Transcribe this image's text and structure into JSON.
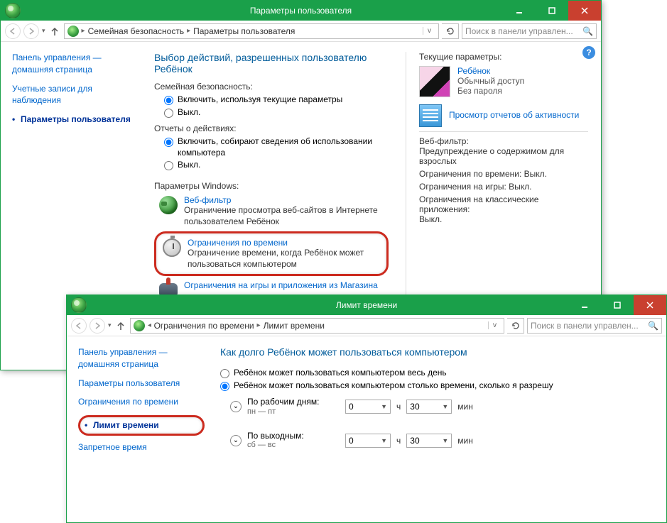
{
  "win1": {
    "title": "Параметры пользователя",
    "breadcrumb": {
      "a": "Семейная безопасность",
      "b": "Параметры пользователя"
    },
    "search_placeholder": "Поиск в панели управлен...",
    "sidebar": {
      "home": "Панель управления — домашняя страница",
      "accounts": "Учетные записи для наблюдения",
      "params": "Параметры пользователя"
    },
    "heading": "Выбор действий, разрешенных пользователю Ребёнок",
    "family_safety_label": "Семейная безопасность:",
    "fs_on": "Включить, используя текущие параметры",
    "fs_off": "Выкл.",
    "activity_label": "Отчеты о действиях:",
    "act_on": "Включить, собирают сведения об использовании компьютера",
    "act_off": "Выкл.",
    "win_params_label": "Параметры Windows:",
    "web_filter_title": "Веб-фильтр",
    "web_filter_desc": "Ограничение просмотра веб-сайтов в Интернете пользователем Ребёнок",
    "time_title": "Ограничения по времени",
    "time_desc": "Ограничение времени, когда Ребёнок может пользоваться компьютером",
    "games_title": "Ограничения на игры и приложения из Магазина",
    "right": {
      "current_label": "Текущие параметры:",
      "user_name": "Ребёнок",
      "user_type": "Обычный доступ",
      "user_pwd": "Без пароля",
      "report_link": "Просмотр отчетов об активности",
      "r1_label": "Веб-фильтр:",
      "r1_val": "Предупреждение о содержимом для взрослых",
      "r2": "Ограничения по времени: Выкл.",
      "r3": "Ограничения на игры: Выкл.",
      "r4_label": "Ограничения на классические приложения:",
      "r4_val": "Выкл."
    }
  },
  "win2": {
    "title": "Лимит времени",
    "breadcrumb": {
      "a": "Ограничения по времени",
      "b": "Лимит времени"
    },
    "search_placeholder": "Поиск в панели управлен...",
    "sidebar": {
      "home": "Панель управления — домашняя страница",
      "params": "Параметры пользователя",
      "time": "Ограничения по времени",
      "limit": "Лимит времени",
      "forbidden": "Запретное время"
    },
    "heading": "Как долго Ребёнок может пользоваться компьютером",
    "opt_all_day": "Ребёнок может пользоваться компьютером весь день",
    "opt_limited": "Ребёнок может пользоваться компьютером столько времени, сколько я разрешу",
    "weekday_label": "По рабочим дням:",
    "weekday_sub": "пн — пт",
    "weekend_label": "По выходным:",
    "weekend_sub": "сб — вс",
    "hours_val": "0",
    "hours_unit": "ч",
    "mins_val": "30",
    "mins_unit": "мин"
  }
}
